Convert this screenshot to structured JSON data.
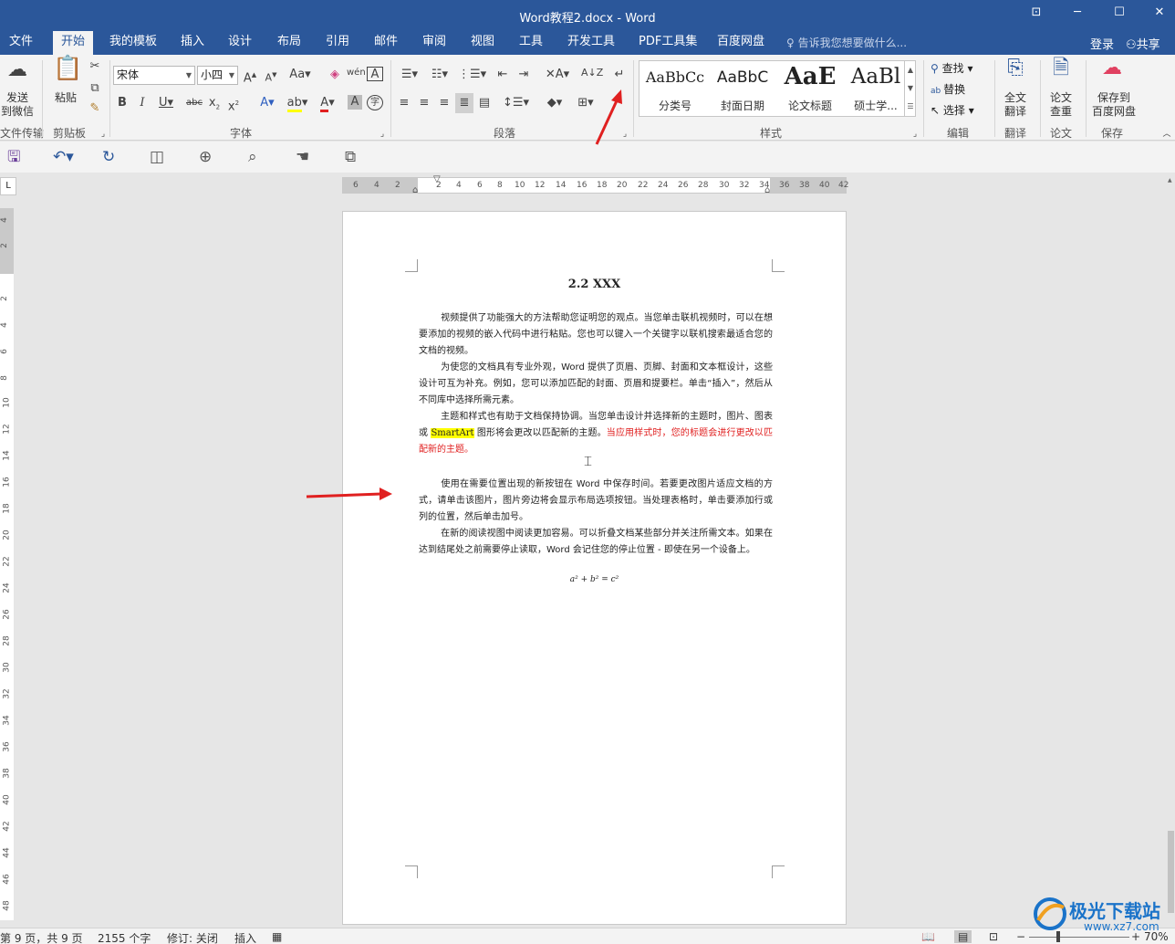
{
  "window": {
    "title": "Word教程2.docx - Word"
  },
  "tabs": [
    "文件",
    "开始",
    "我的模板",
    "插入",
    "设计",
    "布局",
    "引用",
    "邮件",
    "审阅",
    "视图",
    "工具",
    "开发工具",
    "PDF工具集",
    "百度网盘"
  ],
  "tell_me": "告诉我您想要做什么...",
  "account": {
    "login": "登录",
    "share": "共享"
  },
  "ribbon": {
    "send": {
      "line1": "发送",
      "line2": "到微信",
      "group": "文件传输"
    },
    "clipboard": {
      "paste": "粘贴",
      "group": "剪贴板"
    },
    "font": {
      "name": "宋体",
      "size": "小四",
      "group": "字体"
    },
    "paragraph": {
      "group": "段落"
    },
    "styles": {
      "group": "样式",
      "items": [
        {
          "sample": "AaBbCc",
          "name": "分类号"
        },
        {
          "sample": "AaBbC",
          "name": "封面日期"
        },
        {
          "sample": "AaE",
          "name": "论文标题"
        },
        {
          "sample": "AaBl",
          "name": "硕士学..."
        }
      ]
    },
    "editing": {
      "find": "查找",
      "replace": "替换",
      "select": "选择",
      "group": "编辑"
    },
    "translate": {
      "line1": "全文",
      "line2": "翻译",
      "group": "翻译"
    },
    "paper": {
      "line1": "论文",
      "line2": "查重",
      "group": "论文"
    },
    "save": {
      "line1": "保存到",
      "line2": "百度网盘",
      "group": "保存"
    }
  },
  "ruler": {
    "h": [
      "6",
      "4",
      "2",
      "2",
      "4",
      "6",
      "8",
      "10",
      "12",
      "14",
      "16",
      "18",
      "20",
      "22",
      "24",
      "26",
      "28",
      "30",
      "32",
      "34",
      "36",
      "38",
      "40",
      "42"
    ],
    "v": [
      "4",
      "2",
      "2",
      "4",
      "6",
      "8",
      "10",
      "12",
      "14",
      "16",
      "18",
      "20",
      "22",
      "24",
      "26",
      "28",
      "30",
      "32",
      "34",
      "36",
      "38",
      "40",
      "42",
      "44",
      "46",
      "48"
    ]
  },
  "document": {
    "heading": "2.2 XXX",
    "p1": "视频提供了功能强大的方法帮助您证明您的观点。当您单击联机视频时，可以在想要添加的视频的嵌入代码中进行粘贴。您也可以键入一个关键字以联机搜索最适合您的文档的视频。",
    "p2": "为使您的文档具有专业外观，Word 提供了页眉、页脚、封面和文本框设计，这些设计可互为补充。例如，您可以添加匹配的封面、页眉和提要栏。单击“插入”，然后从不同库中选择所需元素。",
    "p3_a": "主题和样式也有助于文档保持协调。当您单击设计并选择新的主题时，图片、图表或",
    "p3_hl": "SmartArt",
    "p3_b": "图形将会更改以匹配新的主题。",
    "p3_red": "当应用样式时，您的标题会进行更改以匹配新的主题。",
    "p4": "使用在需要位置出现的新按钮在 Word 中保存时间。若要更改图片适应文档的方式，请单击该图片，图片旁边将会显示布局选项按钮。当处理表格时，单击要添加行或列的位置，然后单击加号。",
    "p5": "在新的阅读视图中阅读更加容易。可以折叠文档某些部分并关注所需文本。如果在达到结尾处之前需要停止读取，Word 会记住您的停止位置 - 即使在另一个设备上。",
    "formula": "a² + b² = c²"
  },
  "status": {
    "page": "第 9 页，共 9 页",
    "words": "2155 个字",
    "track": "修订: 关闭",
    "mode": "插入",
    "zoom": "70%"
  },
  "watermark": {
    "name": "极光下载站",
    "url": "www.xz7.com"
  },
  "colors": {
    "accent": "#2b579a",
    "arrow": "#e02020",
    "highlight": "#ffff00"
  }
}
